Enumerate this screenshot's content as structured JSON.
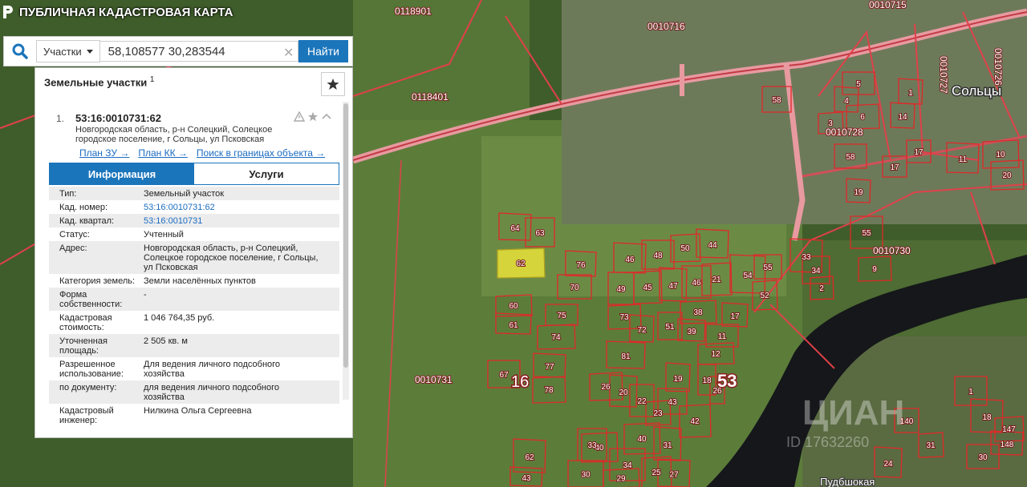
{
  "app": {
    "title": "ПУБЛИЧНАЯ КАДАСТРОВАЯ КАРТА"
  },
  "search": {
    "type_label": "Участки",
    "query": "58,108577 30,283544",
    "find_label": "Найти"
  },
  "panel": {
    "title": "Земельные участки",
    "count_sup": "1",
    "item": {
      "number": "1.",
      "cad_number": "53:16:0010731:62",
      "address_lines": [
        "Новгородская область, р-н Солецкий, Солецкое",
        "городское поселение, г Сольцы, ул Псковская"
      ],
      "links": [
        "План ЗУ →",
        "План КК →",
        "Поиск в границах объекта →"
      ],
      "tabs": [
        "Информация",
        "Услуги"
      ],
      "rows": [
        {
          "k": [
            "Тип:"
          ],
          "v": [
            "Земельный участок"
          ]
        },
        {
          "k": [
            "Кад. номер:"
          ],
          "v": [
            "53:16:0010731:62"
          ],
          "link": true
        },
        {
          "k": [
            "Кад. квартал:"
          ],
          "v": [
            "53:16:0010731"
          ],
          "link": true
        },
        {
          "k": [
            "Статус:"
          ],
          "v": [
            "Учтенный"
          ]
        },
        {
          "k": [
            "Адрес:"
          ],
          "v": [
            "Новгородская область, р-н Солецкий,",
            "Солецкое городское поселение, г Сольцы,",
            "ул Псковская"
          ]
        },
        {
          "k": [
            "Категория земель:"
          ],
          "v": [
            "Земли населённых пунктов"
          ]
        },
        {
          "k": [
            "Форма",
            "собственности:"
          ],
          "v": [
            "-"
          ]
        },
        {
          "k": [
            "Кадастровая",
            "стоимость:"
          ],
          "v": [
            "1 046 764,35 руб."
          ]
        },
        {
          "k": [
            "Уточненная",
            "площадь:"
          ],
          "v": [
            "2 505 кв. м"
          ]
        },
        {
          "k": [
            "Разрешенное",
            "использование:"
          ],
          "v": [
            "Для ведения личного подсобного",
            "хозяйства"
          ]
        },
        {
          "k": [
            "по документу:"
          ],
          "v": [
            "для ведения личного подсобного",
            "хозяйства"
          ]
        },
        {
          "k": [
            "Кадастровый",
            "инженер:"
          ],
          "v": [
            "Нилкина Ольга Сергеевна"
          ]
        }
      ]
    }
  },
  "map": {
    "quarter_labels": [
      "0118901",
      "0010716",
      "0010715",
      "0118401",
      "0010728",
      "0010730",
      "0010731",
      "0010727",
      "0010726"
    ],
    "town_label": "Сольцы",
    "big_labels": [
      "16",
      "53"
    ],
    "parcels": [
      "64",
      "63",
      "62",
      "76",
      "70",
      "60",
      "61",
      "75",
      "74",
      "77",
      "67",
      "78",
      "46",
      "48",
      "50",
      "44",
      "49",
      "45",
      "47",
      "46",
      "21",
      "54",
      "55",
      "38",
      "17",
      "43",
      "40",
      "39",
      "11",
      "12",
      "81",
      "18",
      "73",
      "72",
      "51",
      "26",
      "20",
      "22",
      "23",
      "19",
      "26",
      "42",
      "62",
      "33",
      "40",
      "31",
      "34",
      "25",
      "43",
      "30",
      "29",
      "27",
      "58",
      "52",
      "33",
      "34",
      "2",
      "4",
      "5",
      "6",
      "1",
      "17",
      "20",
      "11",
      "55",
      "9",
      "14",
      "58",
      "3",
      "19",
      "140",
      "147",
      "148",
      "30",
      "31",
      "24",
      "17",
      "10",
      "18",
      "1"
    ],
    "watermark": "ЦИАН",
    "watermark_id": "ID 17632260",
    "bottom_text": "Пудбшокая"
  },
  "colors": {
    "accent": "#1b75bb",
    "parcel": "#e02828",
    "selected": "#e8e13a"
  }
}
